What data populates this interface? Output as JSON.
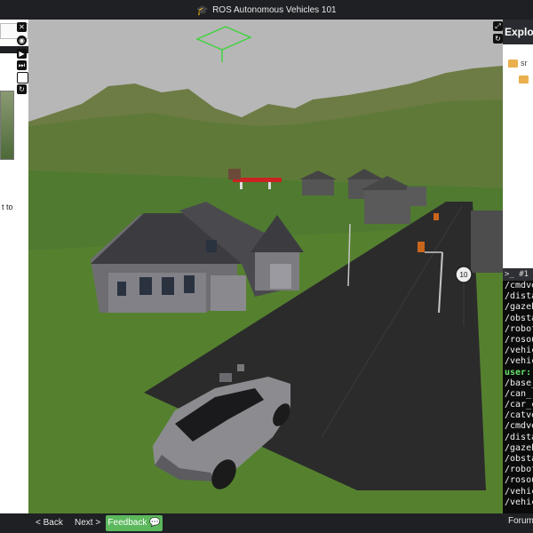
{
  "header": {
    "title": "ROS Autonomous Vehicles 101",
    "icon": "graduation-cap-icon"
  },
  "left_panel": {
    "snippet_text": "t to",
    "tool_icons": [
      "close-icon",
      "eye-icon",
      "forward-icon",
      "step-icon",
      "stop-icon",
      "reset-icon"
    ]
  },
  "explorer": {
    "title": "Explor",
    "items": [
      {
        "label": "sr",
        "icon": "folder-icon"
      },
      {
        "label": "",
        "icon": "folder-icon"
      }
    ],
    "icons": [
      "expand-icon",
      "refresh-icon"
    ]
  },
  "terminal": {
    "tab_label": ">_ #1",
    "lines": [
      {
        "text": "/cmdve",
        "user": false
      },
      {
        "text": "/dista",
        "user": false
      },
      {
        "text": "/gazeb",
        "user": false
      },
      {
        "text": "/obsta",
        "user": false
      },
      {
        "text": "/robot",
        "user": false
      },
      {
        "text": "/rosou",
        "user": false
      },
      {
        "text": "/vehic",
        "user": false
      },
      {
        "text": "/vehic",
        "user": false
      },
      {
        "text": "user:",
        "user": true
      },
      {
        "text": "/base_",
        "user": false
      },
      {
        "text": "/can_",
        "user": false
      },
      {
        "text": "/car_c",
        "user": false
      },
      {
        "text": "/catve",
        "user": false
      },
      {
        "text": "/cmdve",
        "user": false
      },
      {
        "text": "/dista",
        "user": false
      },
      {
        "text": "/gazeb",
        "user": false
      },
      {
        "text": "/obsta",
        "user": false
      },
      {
        "text": "/robot",
        "user": false
      },
      {
        "text": "/rosou",
        "user": false
      },
      {
        "text": "/vehic",
        "user": false
      },
      {
        "text": "/vehic",
        "user": false
      }
    ]
  },
  "scene": {
    "speed_sign": "10"
  },
  "footer": {
    "back_label": "< Back",
    "next_label": "Next >",
    "feedback_label": "Feedback",
    "forum_label": "Forum"
  },
  "colors": {
    "feedback_green": "#5cb85c",
    "terminal_user": "#66e36b",
    "folder": "#e9b04d"
  }
}
